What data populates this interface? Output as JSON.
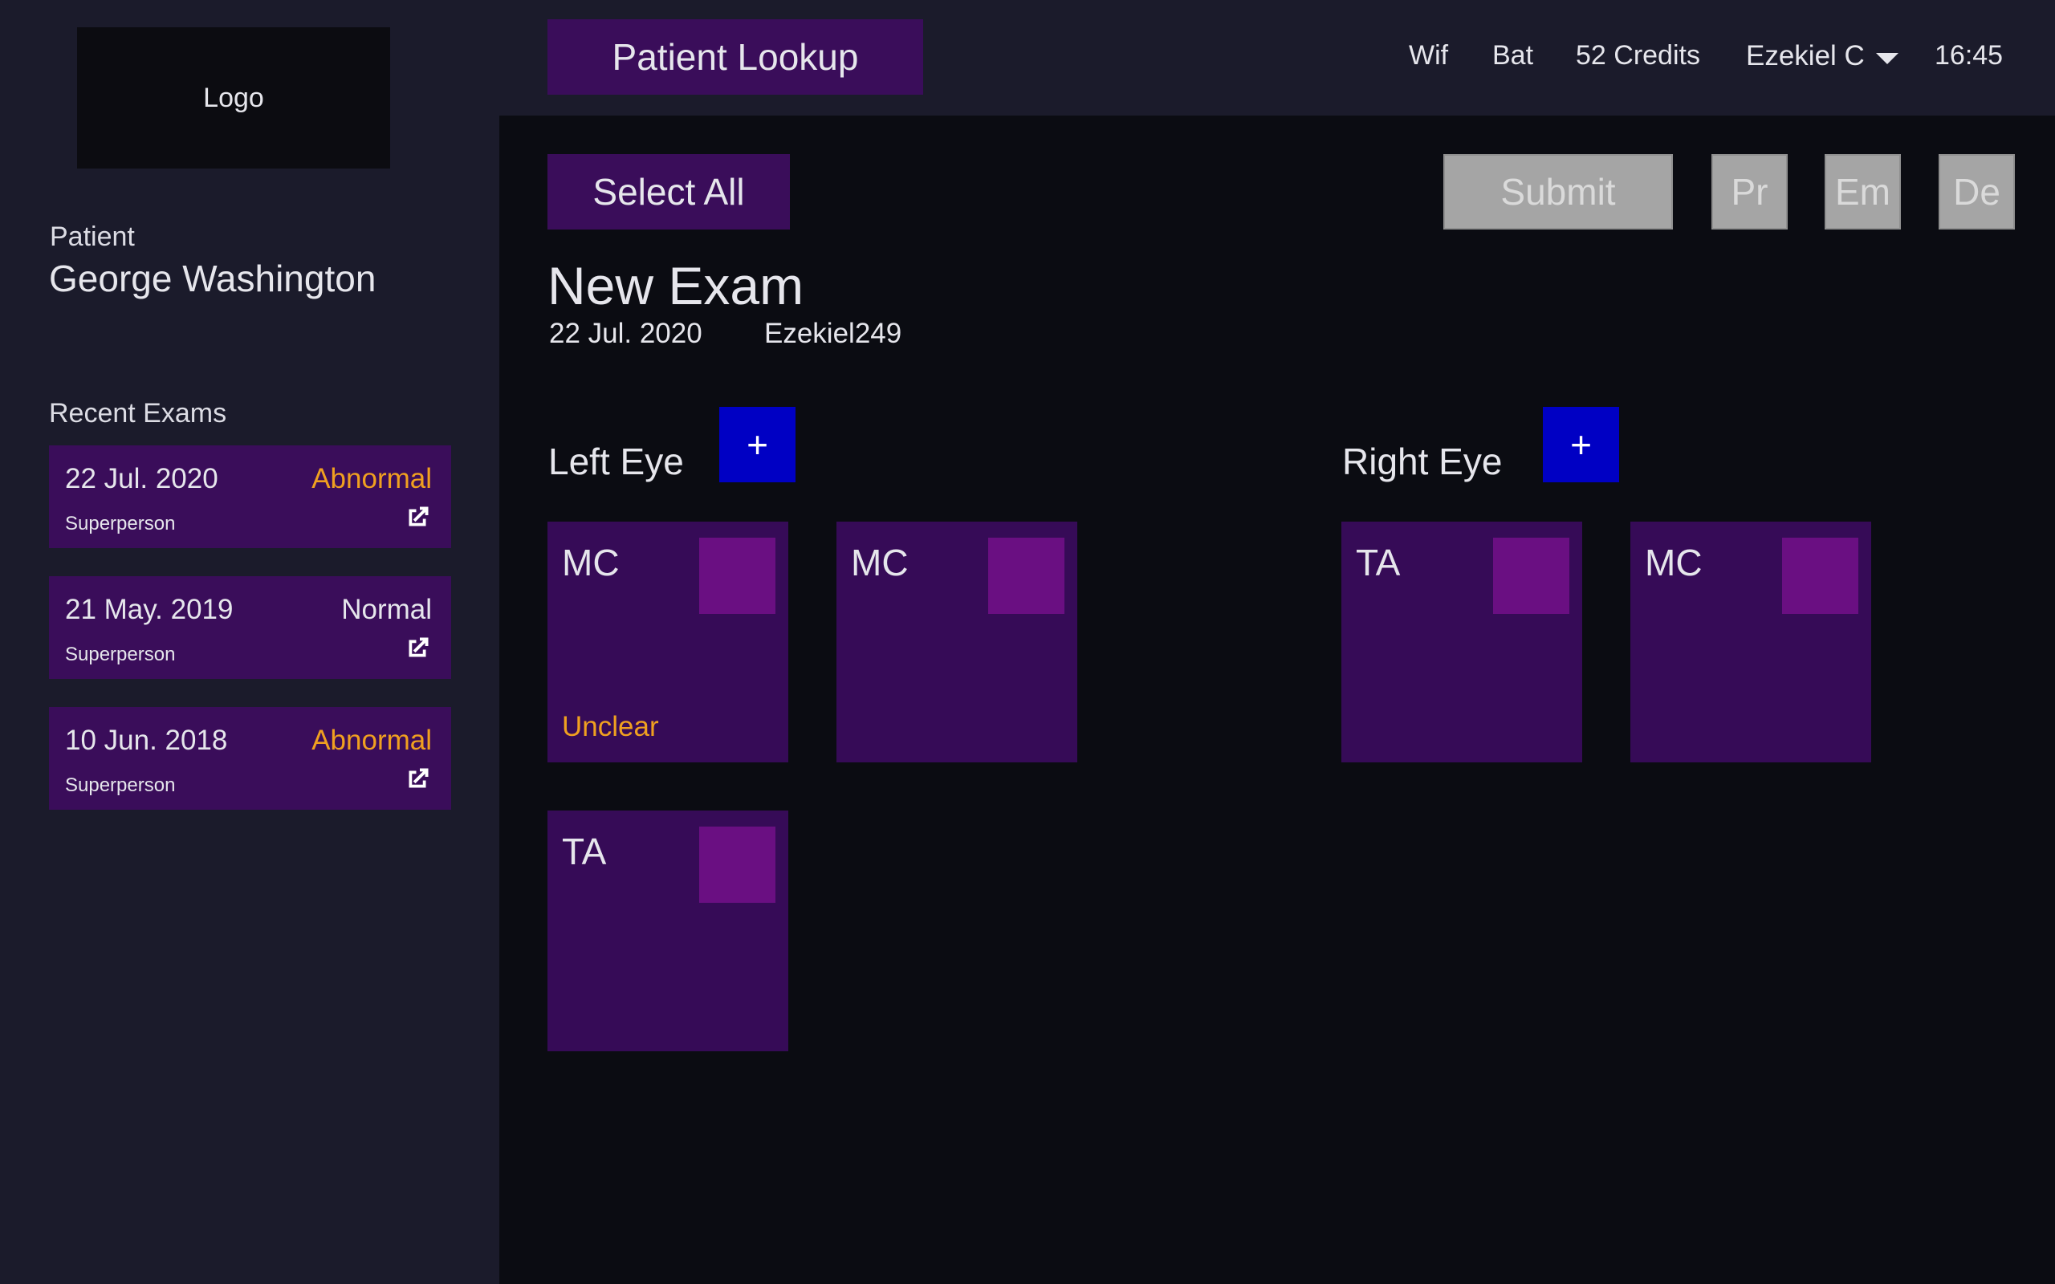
{
  "colors": {
    "accent_purple": "#3a0d5a",
    "card_purple": "#360b57",
    "thumb_purple": "#6a0f82",
    "add_blue": "#0000c4",
    "abnormal": "#f0a020",
    "normal": "#e6e6ec",
    "disabled_gray": "#a5a5a5"
  },
  "sidebar": {
    "logo": "Logo",
    "patient_caption": "Patient",
    "patient_name": "George Washington",
    "recent_title": "Recent Exams",
    "exams": [
      {
        "date": "22 Jul. 2020",
        "status": "Abnormal",
        "status_color": "#f0a020",
        "by": "Superperson",
        "icon": "external-link-icon"
      },
      {
        "date": "21 May. 2019",
        "status": "Normal",
        "status_color": "#e6e6ec",
        "by": "Superperson",
        "icon": "external-link-icon"
      },
      {
        "date": "10 Jun. 2018",
        "status": "Abnormal",
        "status_color": "#f0a020",
        "by": "Superperson",
        "icon": "external-link-icon"
      }
    ]
  },
  "header": {
    "lookup_label": "Patient Lookup",
    "wifi": "Wif",
    "battery": "Bat",
    "credits": "52 Credits",
    "user": "Ezekiel C",
    "time": "16:45"
  },
  "toolbar": {
    "select_all": "Select All",
    "submit": "Submit",
    "pr": "Pr",
    "em": "Em",
    "de": "De"
  },
  "exam": {
    "title": "New Exam",
    "date": "22 Jul. 2020",
    "operator": "Ezekiel249"
  },
  "left_eye": {
    "label": "Left Eye",
    "add_label": "+",
    "images": [
      {
        "code": "MC",
        "flag": "Unclear",
        "flag_color": "#f0a020"
      },
      {
        "code": "MC",
        "flag": ""
      },
      {
        "code": "TA",
        "flag": ""
      }
    ]
  },
  "right_eye": {
    "label": "Right Eye",
    "add_label": "+",
    "images": [
      {
        "code": "TA",
        "flag": ""
      },
      {
        "code": "MC",
        "flag": ""
      }
    ]
  }
}
